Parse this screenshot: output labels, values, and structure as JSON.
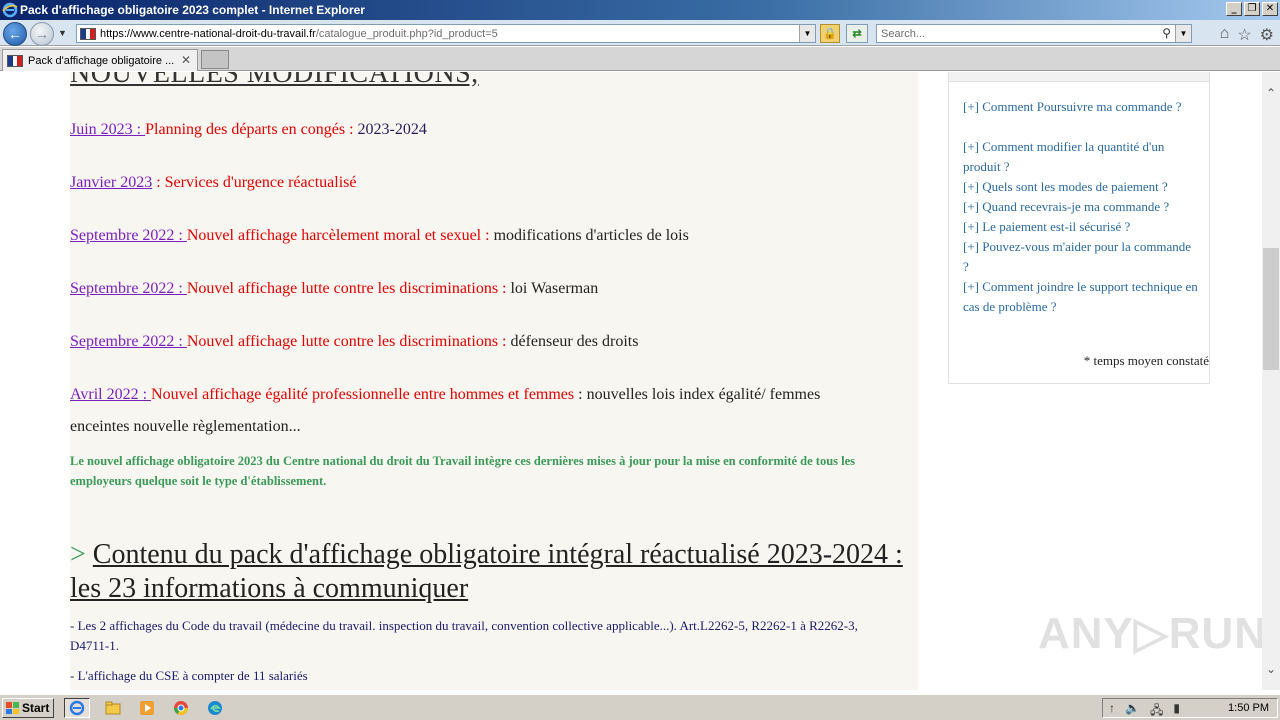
{
  "window": {
    "title": "Pack d'affichage obligatoire 2023 complet - Internet Explorer",
    "controls": [
      "_",
      "❐",
      "✕"
    ]
  },
  "address": {
    "host": "https://www.centre-national-droit-du-travail.fr",
    "path": "/catalogue_produit.php?id_product=5",
    "search_placeholder": "Search..."
  },
  "tab": {
    "label": "Pack d'affichage obligatoire ...",
    "close": "✕"
  },
  "content": {
    "heading_cut": "NOUVELLES MODIFICATIONS,",
    "updates": [
      {
        "date": "Juin 2023 : ",
        "title": "Planning des départs en congés : ",
        "detail": "2023-2024"
      },
      {
        "date": "Janvier 2023",
        "title": " : Services d'urgence réactualisé",
        "detail": ""
      },
      {
        "date": "Septembre 2022 : ",
        "title": "Nouvel affichage harcèlement moral et sexuel : ",
        "detail": " modifications d'articles de lois"
      },
      {
        "date": "Septembre 2022 : ",
        "title": "Nouvel affichage lutte contre les discriminations : ",
        "detail": " loi Waserman"
      },
      {
        "date": "Septembre 2022 : ",
        "title": "Nouvel affichage lutte contre les discriminations : ",
        "detail": " défenseur des droits"
      },
      {
        "date": "Avril 2022 : ",
        "title": "Nouvel affichage égalité professionnelle entre hommes et femmes",
        "detail": " : nouvelles lois index égalité/ femmes"
      }
    ],
    "avril_line2": "enceintes nouvelle règlementation...",
    "green_note": "Le nouvel affichage obligatoire 2023 du Centre national du droit du Travail intègre ces dernières mises à jour pour la mise en conformité de tous les employeurs quelque soit le type d'établissement.",
    "contenu_arrow": ">",
    "contenu_title": "Contenu du pack d'affichage obligatoire intégral réactualisé 2023-2024 : les 23 informations à communiquer",
    "list": [
      "- Les 2 affichages du Code du travail (médecine du travail. inspection du travail, convention collective applicable...). Art.L2262-5, R2262-1 à R2262-3, D4711-1.",
      "- L'affichage du CSE à compter de 11 salariés"
    ]
  },
  "sidebar": {
    "faq": [
      "[+] Comment Poursuivre ma commande ?",
      "[+] Comment modifier la quantité d'un produit ?",
      "[+] Quels sont les modes de paiement ?",
      "[+] Quand recevrais-je ma commande ?",
      "[+] Le paiement est-il sécurisé ?",
      "[+] Pouvez-vous m'aider pour la commande ?",
      "[+] Comment joindre le support technique en cas de problème ?"
    ],
    "note": "* temps moyen constaté"
  },
  "watermark": "ANY▷RUN",
  "taskbar": {
    "start": "Start",
    "clock": "1:50 PM"
  },
  "colors": {
    "date_link": "#7a1fbf",
    "red_title": "#e00000",
    "green_note": "#3a9a5a",
    "faq_link": "#2a6aa0"
  }
}
